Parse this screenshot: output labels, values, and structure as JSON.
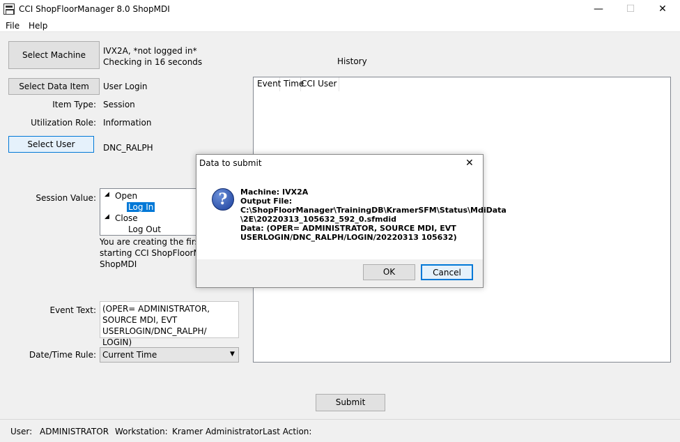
{
  "window": {
    "title": "CCI ShopFloorManager 8.0 ShopMDI",
    "minimize": "—",
    "maximize": "☐",
    "close": "✕"
  },
  "menu": {
    "file": "File",
    "help": "Help"
  },
  "machine": {
    "button": "Select Machine",
    "status_line1": "IVX2A, *not logged in*",
    "status_line2": "Checking in 16 seconds"
  },
  "history": {
    "label": "History",
    "columns": [
      "Event",
      "Time",
      "CCI User"
    ]
  },
  "data_item": {
    "button": "Select Data Item",
    "value": "User Login"
  },
  "item_type": {
    "label": "Item Type:",
    "value": "Session"
  },
  "utilization_role": {
    "label": "Utilization Role:",
    "value": "Information"
  },
  "user": {
    "button": "Select User",
    "value": "DNC_RALPH"
  },
  "session_value": {
    "label": "Session Value:",
    "tree": [
      {
        "label": "Open",
        "children": [
          "Log In"
        ],
        "selected_child": "Log In"
      },
      {
        "label": "Close",
        "children": [
          "Log Out"
        ]
      }
    ],
    "expander": "◢"
  },
  "info_text": {
    "line1": "You are creating the first e",
    "line2": "starting CCI ShopFloorMar",
    "line3": "ShopMDI"
  },
  "event_text": {
    "label": "Event Text:",
    "value": "(OPER= ADMINISTRATOR, SOURCE MDI, EVT USERLOGIN/DNC_RALPH/ LOGIN)"
  },
  "datetime_rule": {
    "label": "Date/Time Rule:",
    "value": "Current Time",
    "arrow": "▼"
  },
  "submit": {
    "label": "Submit"
  },
  "status": {
    "user_label": "User:",
    "user_value": "ADMINISTRATOR",
    "workstation_label": "Workstation:",
    "workstation_value": "Kramer Administrator",
    "last_action_label": "Last Action:"
  },
  "dialog": {
    "title": "Data to submit",
    "close": "✕",
    "icon": "question-icon",
    "lines": [
      "Machine: IVX2A",
      "Output File:",
      "C:\\ShopFloorManager\\TrainingDB\\KramerSFM\\Status\\MdiData",
      "\\2E\\20220313_105632_592_0.sfmdid",
      "Data: (OPER= ADMINISTRATOR, SOURCE MDI, EVT",
      "USERLOGIN/DNC_RALPH/LOGIN/20220313 105632)"
    ],
    "ok": "OK",
    "cancel": "Cancel"
  }
}
